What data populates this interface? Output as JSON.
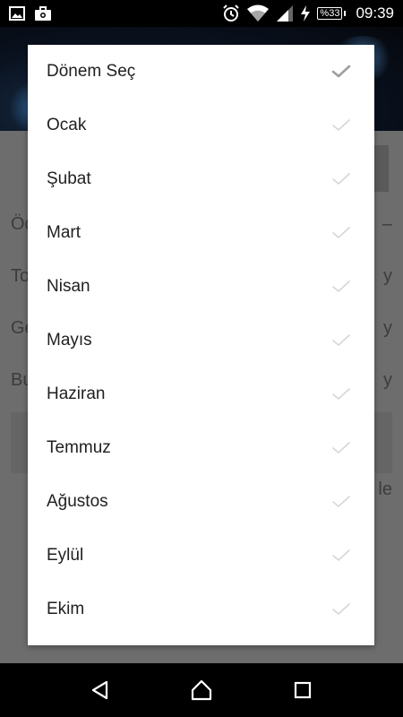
{
  "status_bar": {
    "left_icons": [
      "image-icon",
      "briefcase-icon"
    ],
    "right_icons": [
      "alarm-icon",
      "wifi-icon",
      "signal-icon",
      "charging-icon"
    ],
    "battery": "%33",
    "time": "09:39"
  },
  "background": {
    "rows": [
      {
        "left": "Öd",
        "right": "–"
      },
      {
        "left": "To",
        "right": "y"
      },
      {
        "left": "Ge",
        "right": "y"
      },
      {
        "left": "Bu",
        "right": "y"
      }
    ],
    "card_right_text": "le"
  },
  "dialog": {
    "title": "Dönem Seç",
    "items": [
      {
        "label": "Ocak"
      },
      {
        "label": "Şubat"
      },
      {
        "label": "Mart"
      },
      {
        "label": "Nisan"
      },
      {
        "label": "Mayıs"
      },
      {
        "label": "Haziran"
      },
      {
        "label": "Temmuz"
      },
      {
        "label": "Ağustos"
      },
      {
        "label": "Eylül"
      },
      {
        "label": "Ekim"
      }
    ],
    "check_color_selected": "#9e9e9e",
    "check_color_unselected": "#d6d6d6"
  },
  "nav_bar": {
    "buttons": [
      "back-icon",
      "home-icon",
      "recents-icon"
    ]
  }
}
